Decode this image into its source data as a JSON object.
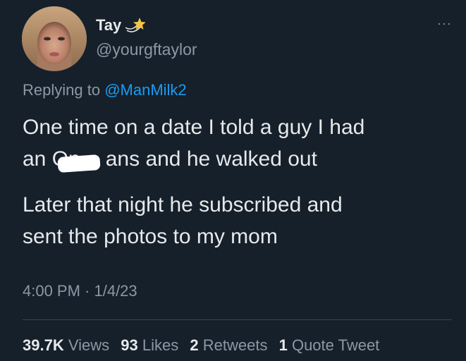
{
  "author": {
    "name": "Tay",
    "handle": "@yourgftaylor",
    "badge_icon": "shooting-star-icon"
  },
  "more_icon": "more-icon",
  "reply": {
    "prefix": "Replying to",
    "mention": "@ManMilk2"
  },
  "body": {
    "line1": "One time on a date I told a guy I had",
    "line2_start": "an On",
    "line2_end": "ans and he walked out",
    "line3": "Later that night he subscribed and",
    "line4": "sent the photos to my mom"
  },
  "timestamp": "4:00 PM · 1/4/23",
  "stats": {
    "views_count": "39.7K",
    "views_label": "Views",
    "likes_count": "93",
    "likes_label": "Likes",
    "retweets_count": "2",
    "retweets_label": "Retweets",
    "quotes_count": "1",
    "quotes_label": "Quote Tweet"
  },
  "colors": {
    "background": "#15202b",
    "text": "#e7e9ea",
    "secondary": "#8b98a5",
    "accent": "#1d9bf0"
  }
}
